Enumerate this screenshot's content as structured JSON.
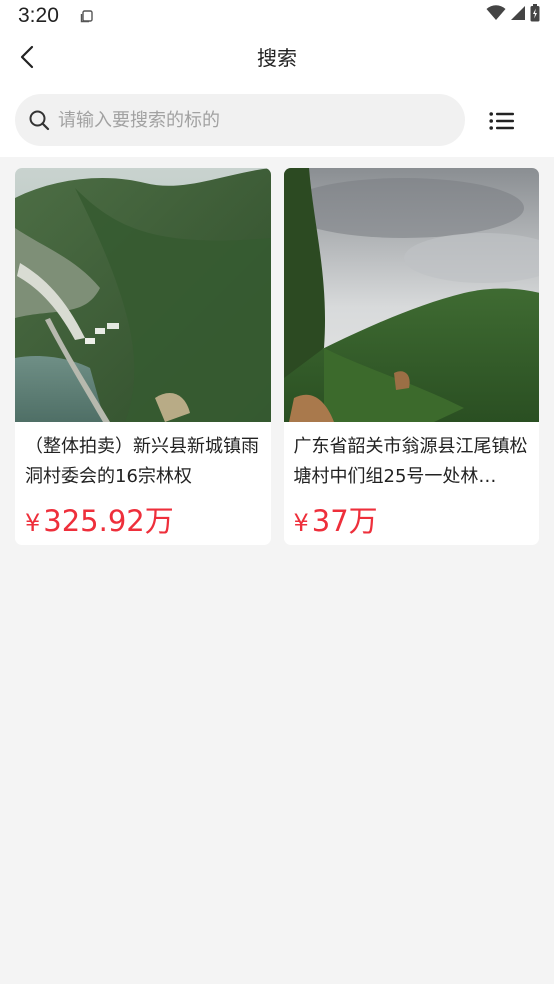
{
  "status_bar": {
    "time": "3:20",
    "icons": [
      "notification-icon",
      "wifi-icon",
      "signal-icon",
      "battery-icon"
    ]
  },
  "header": {
    "title": "搜索",
    "back_icon": "back-chevron-icon"
  },
  "search": {
    "placeholder": "请输入要搜索的标的",
    "value": "",
    "icon": "search-icon",
    "menu_icon": "list-menu-icon"
  },
  "listings": [
    {
      "title": "（整体拍卖）新兴县新城镇雨洞村委会的16宗林权",
      "currency": "¥",
      "price": "325.92万",
      "image": "aerial-forest-hillside-lake-photo"
    },
    {
      "title": "广东省韶关市翁源县江尾镇松塘村中们组25号一处林…",
      "currency": "¥",
      "price": "37万",
      "image": "forest-hill-cloudy-sky-photo"
    }
  ],
  "colors": {
    "price": "#ee2f3b",
    "background": "#f4f4f4",
    "search_bg": "#f1f1f1"
  }
}
